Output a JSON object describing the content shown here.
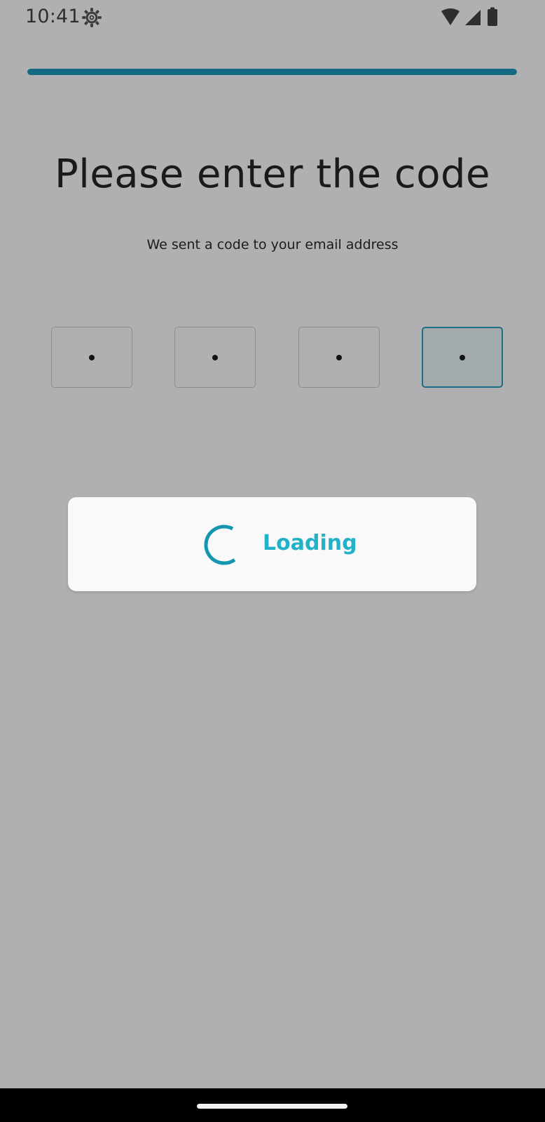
{
  "status_bar": {
    "time": "10:41",
    "icons": [
      "settings-gear-icon",
      "wifi-icon",
      "cellular-signal-icon",
      "battery-icon"
    ]
  },
  "progress": {
    "value": 1.0,
    "fill_color": "#146a82"
  },
  "header": {
    "title": "Please enter the code",
    "subtitle": "We sent a code to your email address"
  },
  "code_inputs": [
    {
      "value": "•",
      "active": false
    },
    {
      "value": "•",
      "active": false
    },
    {
      "value": "•",
      "active": false
    },
    {
      "value": "•",
      "active": true
    }
  ],
  "loading_dialog": {
    "label": "Loading",
    "accent_color": "#22b2c8",
    "spinner_color": "#1596b0"
  },
  "colors": {
    "scrim_background": "#b0b0b2",
    "active_border": "#1a6f86"
  }
}
